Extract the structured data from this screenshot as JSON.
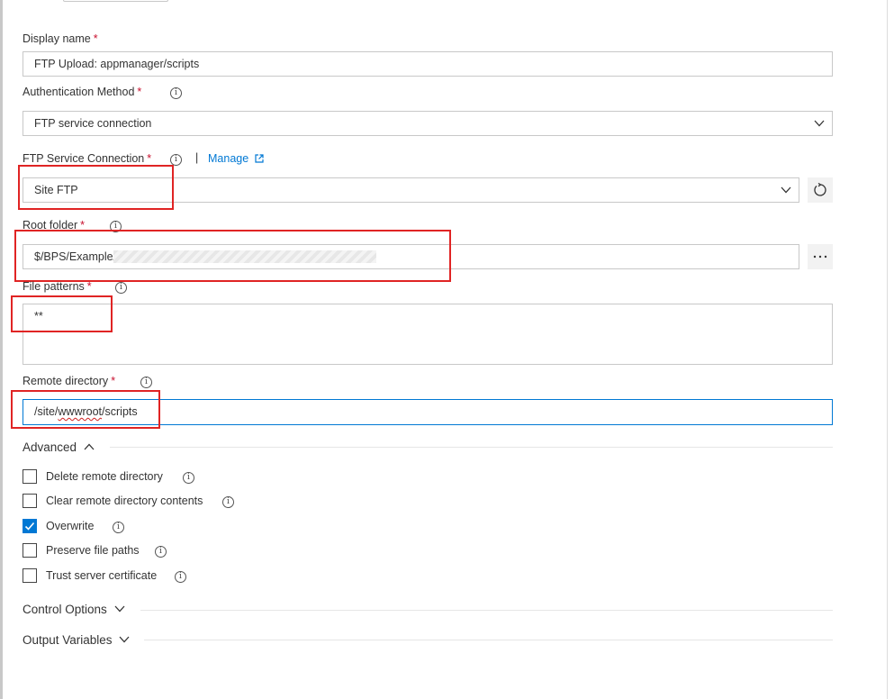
{
  "form": {
    "display_name": {
      "label": "Display name",
      "required": "*",
      "value": "FTP Upload: appmanager/scripts"
    },
    "auth_method": {
      "label": "Authentication Method",
      "required": "*",
      "value": "FTP service connection"
    },
    "ftp_service_connection": {
      "label": "FTP Service Connection",
      "required": "*",
      "separator": "|",
      "manage_label": "Manage",
      "value": "Site FTP"
    },
    "root_folder": {
      "label": "Root folder",
      "required": "*",
      "value": "$/BPS/Example/"
    },
    "file_patterns": {
      "label": "File patterns",
      "required": "*",
      "value": "**"
    },
    "remote_directory": {
      "label": "Remote directory",
      "required": "*",
      "value_prefix": "/site/",
      "value_squiggle": "wwwroot",
      "value_suffix": "/scripts"
    }
  },
  "advanced": {
    "title": "Advanced",
    "options": [
      {
        "label": "Delete remote directory",
        "checked": false
      },
      {
        "label": "Clear remote directory contents",
        "checked": false
      },
      {
        "label": "Overwrite",
        "checked": true
      },
      {
        "label": "Preserve file paths",
        "checked": false
      },
      {
        "label": "Trust server certificate",
        "checked": false
      }
    ]
  },
  "sections": {
    "control_options": "Control Options",
    "output_variables": "Output Variables"
  },
  "icons": {
    "info": "info-icon",
    "external": "external-link-icon",
    "refresh": "refresh-icon",
    "ellipsis": "ellipsis-icon",
    "chevron": "chevron-icon"
  },
  "colors": {
    "accent": "#0078d4",
    "required": "#c8102e",
    "highlight": "#e02424"
  }
}
